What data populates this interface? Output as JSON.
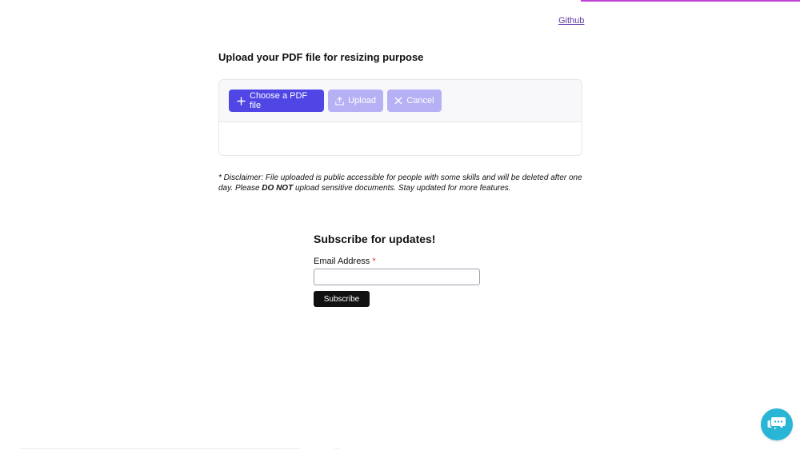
{
  "header": {
    "github_link": "Github"
  },
  "upload": {
    "title": "Upload your PDF file for resizing purpose",
    "choose_label": "Choose a PDF file",
    "upload_label": "Upload",
    "cancel_label": "Cancel"
  },
  "disclaimer": {
    "before": "* Disclaimer: File uploaded is public accessible for people with some skills and will be deleted after one day. Please ",
    "emphasis": "DO NOT",
    "after": " upload sensitive documents. Stay updated for more features."
  },
  "subscribe": {
    "title": "Subscribe for updates!",
    "email_label": "Email Address",
    "required_mark": "*",
    "email_value": "",
    "button_label": "Subscribe"
  },
  "colors": {
    "primary": "#4f46e5",
    "primary_disabled": "#b6b1f4",
    "accent": "#c042d6",
    "chat_widget": "#29b5d6"
  },
  "icons": {
    "choose": "plus-icon",
    "upload": "upload-icon",
    "cancel": "close-icon",
    "chat": "chat-bubbles-icon"
  }
}
